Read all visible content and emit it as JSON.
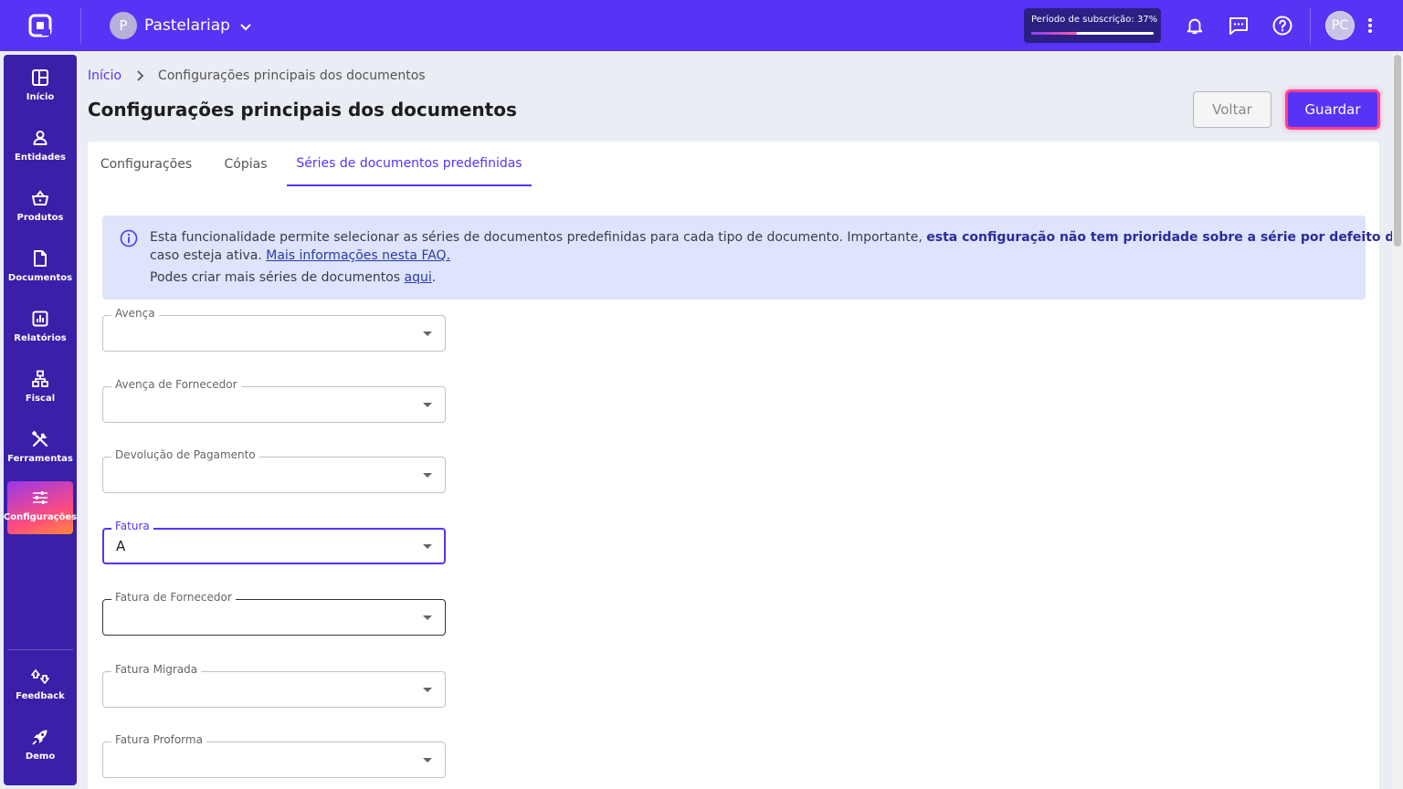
{
  "app": {
    "company_initial": "P",
    "company_name": "Pastelariap",
    "subscription_label": "Período de subscrição: 37%",
    "subscription_progress": 0.37,
    "user_initials": "PC",
    "brand_color": "#5733f5",
    "sidebar_color": "#3a1fa8"
  },
  "sidebar": {
    "items": [
      {
        "label": "Início",
        "icon": "dashboard-icon"
      },
      {
        "label": "Entidades",
        "icon": "person-icon"
      },
      {
        "label": "Produtos",
        "icon": "basket-icon"
      },
      {
        "label": "Documentos",
        "icon": "document-icon"
      },
      {
        "label": "Relatórios",
        "icon": "chart-icon"
      },
      {
        "label": "Fiscal",
        "icon": "fiscal-icon"
      },
      {
        "label": "Ferramentas",
        "icon": "tools-icon"
      },
      {
        "label": "Configurações",
        "icon": "sliders-icon",
        "active": true
      }
    ],
    "bottom": [
      {
        "label": "Feedback",
        "icon": "feedback-icon"
      },
      {
        "label": "Demo",
        "icon": "rocket-icon"
      }
    ]
  },
  "breadcrumb": {
    "home": "Início",
    "current": "Configurações principais dos documentos"
  },
  "page": {
    "title": "Configurações principais dos documentos",
    "back_label": "Voltar",
    "save_label": "Guardar"
  },
  "tabs": [
    {
      "label": "Configurações"
    },
    {
      "label": "Cópias"
    },
    {
      "label": "Séries de documentos predefinidas",
      "active": true
    }
  ],
  "info": {
    "text1": "Esta funcionalidade permite selecionar as séries de documentos predefinidas para cada tipo de documento. Importante, ",
    "text1_bold": "esta configuração não tem prioridade sobre a série por defeito do cliente,",
    "text2": "caso esteja ativa. ",
    "text2_link": "Mais informações nesta FAQ.",
    "text3": "Podes criar mais séries de documentos ",
    "text3_link": "aqui",
    "text3_end": "."
  },
  "fields": [
    {
      "label": "Avença",
      "value": ""
    },
    {
      "label": "Avença de Fornecedor",
      "value": ""
    },
    {
      "label": "Devolução de Pagamento",
      "value": ""
    },
    {
      "label": "Fatura",
      "value": "A"
    },
    {
      "label": "Fatura de Fornecedor",
      "value": ""
    },
    {
      "label": "Fatura Migrada",
      "value": ""
    },
    {
      "label": "Fatura Proforma",
      "value": ""
    }
  ]
}
